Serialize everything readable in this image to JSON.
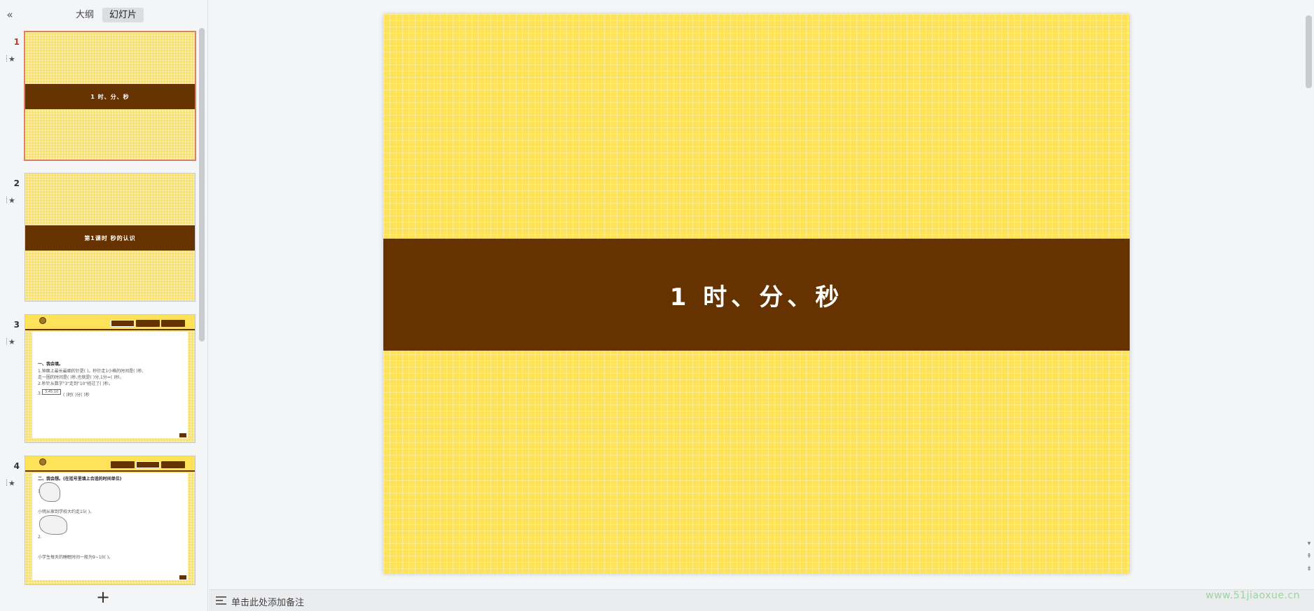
{
  "sidebar": {
    "collapse_icon": "«",
    "tabs": [
      {
        "label": "大纲",
        "active": false
      },
      {
        "label": "幻灯片",
        "active": true
      }
    ],
    "slides": [
      {
        "number": "1",
        "title": "1  时、分、秒",
        "active": true
      },
      {
        "number": "2",
        "title": "第1课时   秒的认识",
        "active": false
      },
      {
        "number": "3",
        "lines": [
          "一、我会填。",
          "1.钟面上最长最细的针是(        )。秒针走1小格的时间是(     )秒,",
          "走一圈的时间是(        )秒,也就是(       )分,1分=(        )秒。",
          "2.秒针从数字\"3\"走到\"10\"经过了(       )秒。",
          "3.",
          "(      )时(       )分(       )秒"
        ],
        "clock_text": "3:45:10"
      },
      {
        "number": "4",
        "lines": [
          "二、我会想。(在括号里填上合适的时间单位)",
          "1.",
          "小明从家到学校大约走15(         )。",
          "2.",
          "小学生每天的睡眠时间一般为9~10(          )。"
        ]
      }
    ],
    "add_icon": "+"
  },
  "main": {
    "slide_title": "1  时、分、秒",
    "colors": {
      "background": "#fde25a",
      "band": "#663300",
      "title": "#ffffff"
    }
  },
  "notes": {
    "placeholder": "单击此处添加备注"
  },
  "watermark": "www.51jiaoxue.cn"
}
